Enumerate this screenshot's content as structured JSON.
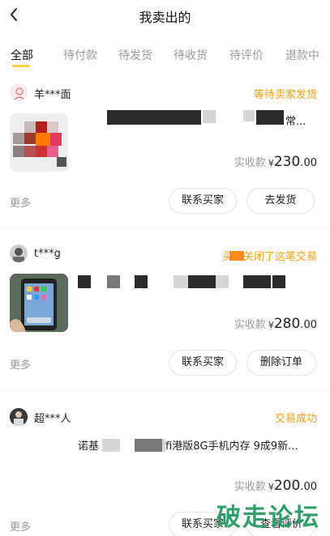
{
  "header": {
    "title": "我卖出的",
    "back_icon": "chevron-left-icon"
  },
  "tabs": [
    "全部",
    "待付款",
    "待发货",
    "待收货",
    "待评价",
    "退款中"
  ],
  "accent_color": "#ffd33d",
  "status_color": "#f0a010",
  "orders": [
    {
      "user": "羊***面",
      "status": "等待卖家发货",
      "product_text": "常...",
      "amount_label": "实收款",
      "currency": "¥",
      "amount_int": "230",
      "amount_dec": ".00",
      "more": "更多",
      "buttons": [
        "联系买家",
        "去发货"
      ]
    },
    {
      "user": "t***g",
      "status": "买家关闭了这笔交易",
      "product_text": "",
      "amount_label": "实收款",
      "currency": "¥",
      "amount_int": "280",
      "amount_dec": ".00",
      "more": "更多",
      "buttons": [
        "联系买家",
        "删除订单"
      ]
    },
    {
      "user": "超***人",
      "status": "交易成功",
      "product_text_a": "诺基",
      "product_text_b": "fi港版8G手机内存 9成9新...",
      "amount_label": "实收款",
      "currency": "¥",
      "amount_int": "200",
      "amount_dec": ".00",
      "more": "更多",
      "buttons": [
        "联系买家",
        "查看评价"
      ]
    }
  ],
  "watermark": "破走论坛"
}
